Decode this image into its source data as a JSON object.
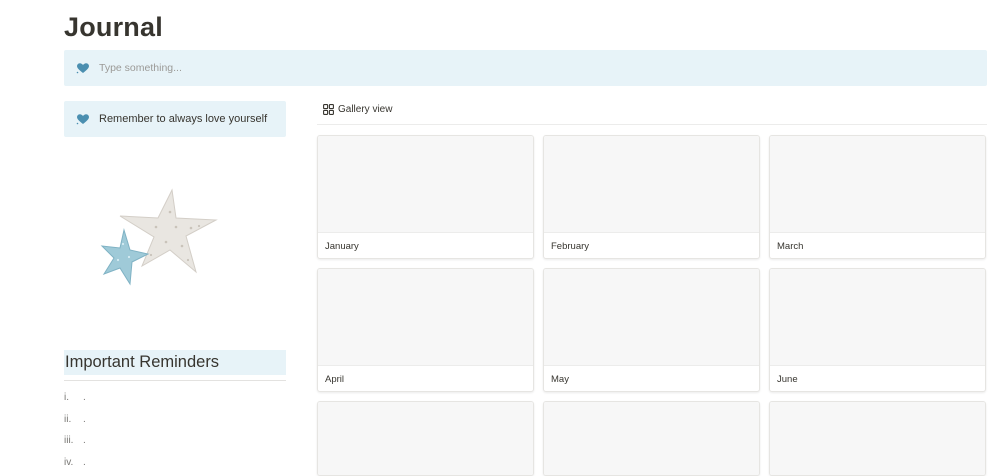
{
  "page": {
    "title": "Journal"
  },
  "callouts": {
    "top": {
      "icon": "heart-icon",
      "placeholder": "Type something..."
    },
    "left": {
      "icon": "heart-icon",
      "text": "Remember to always love yourself"
    }
  },
  "image": {
    "subject": "starfish-image"
  },
  "reminders": {
    "heading": "Important Reminders",
    "items": [
      {
        "num": "i.",
        "text": "."
      },
      {
        "num": "ii.",
        "text": "."
      },
      {
        "num": "iii.",
        "text": "."
      },
      {
        "num": "iv.",
        "text": "."
      }
    ]
  },
  "gallery": {
    "view_label": "Gallery view",
    "view_icon": "grid-icon",
    "cards": [
      {
        "title": "January"
      },
      {
        "title": "February"
      },
      {
        "title": "March"
      },
      {
        "title": "April"
      },
      {
        "title": "May"
      },
      {
        "title": "June"
      },
      {
        "title": ""
      },
      {
        "title": ""
      },
      {
        "title": ""
      }
    ]
  },
  "colors": {
    "callout_bg": "#e7f3f8",
    "heart": "#4b8fb0",
    "text": "#37352f",
    "muted": "#9b9a97"
  }
}
